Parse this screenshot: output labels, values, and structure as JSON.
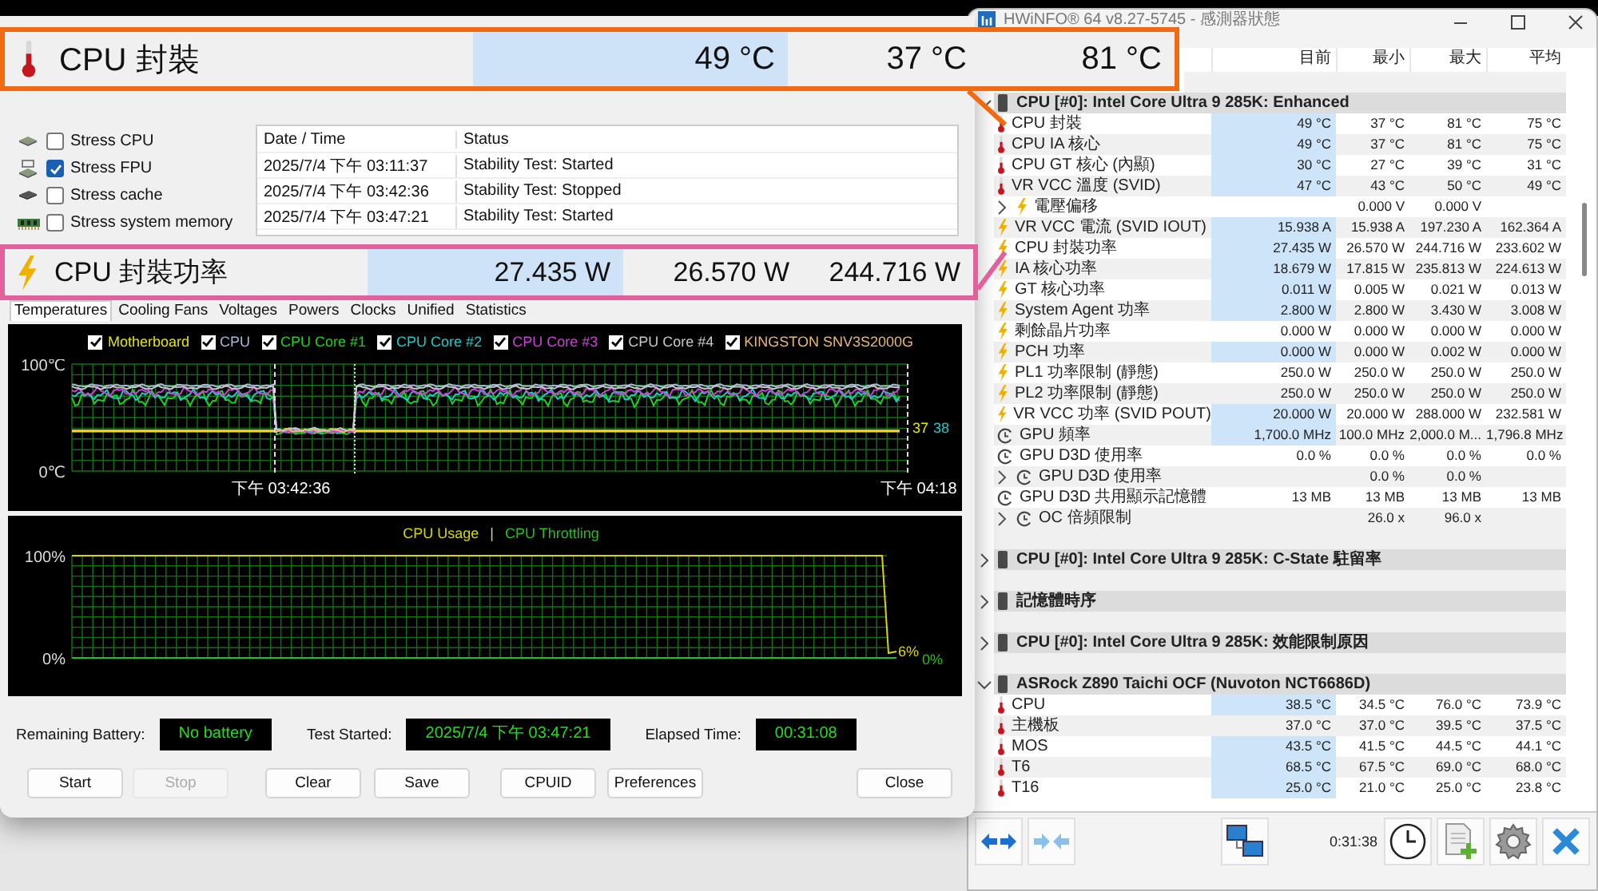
{
  "callouts": [
    {
      "kind": "temperature",
      "color": "#f26a10",
      "label": "CPU 封裝",
      "values": [
        "49 °C",
        "37 °C",
        "81 °C"
      ]
    },
    {
      "kind": "power",
      "color": "#e2609c",
      "label": "CPU 封裝功率",
      "values": [
        "27.435 W",
        "26.570 W",
        "244.716 W"
      ]
    }
  ],
  "stress_window": {
    "stress_options": [
      {
        "label": "Stress CPU",
        "checked": false
      },
      {
        "label": "Stress FPU",
        "checked": true
      },
      {
        "label": "Stress cache",
        "checked": false
      },
      {
        "label": "Stress system memory",
        "checked": false
      }
    ],
    "log": {
      "columns": [
        "Date / Time",
        "Status"
      ],
      "rows": [
        [
          "2025/7/4 下午 03:11:37",
          "Stability Test: Started"
        ],
        [
          "2025/7/4 下午 03:42:36",
          "Stability Test: Stopped"
        ],
        [
          "2025/7/4 下午 03:47:21",
          "Stability Test: Started"
        ]
      ]
    },
    "tabs": [
      {
        "label": "Temperatures",
        "selected": true
      },
      {
        "label": "Cooling Fans",
        "selected": false
      },
      {
        "label": "Voltages",
        "selected": false
      },
      {
        "label": "Powers",
        "selected": false
      },
      {
        "label": "Clocks",
        "selected": false
      },
      {
        "label": "Unified",
        "selected": false
      },
      {
        "label": "Statistics",
        "selected": false
      }
    ],
    "temperature_chart": {
      "legend": [
        {
          "label": "Motherboard",
          "color": "#e6e600",
          "checked": true
        },
        {
          "label": "CPU",
          "color": "#a8b8d8",
          "checked": true
        },
        {
          "label": "CPU Core #1",
          "color": "#20d020",
          "checked": true
        },
        {
          "label": "CPU Core #2",
          "color": "#20c8c8",
          "checked": true
        },
        {
          "label": "CPU Core #3",
          "color": "#d040d8",
          "checked": true
        },
        {
          "label": "CPU Core #4",
          "color": "#c8c8c8",
          "checked": true
        },
        {
          "label": "KINGSTON SNV3S2000G",
          "color": "#e8b878",
          "checked": true
        }
      ],
      "y_labels": [
        "100℃",
        "0℃"
      ],
      "time_labels": [
        "下午 03:42:36",
        "下午 04:18"
      ],
      "end_readings": [
        {
          "text": "37",
          "color": "#e6e600"
        },
        {
          "text": "38",
          "color": "#20c8c8"
        }
      ]
    },
    "usage_chart": {
      "legend": [
        {
          "label": "CPU Usage",
          "color": "#d8d800"
        },
        {
          "label": "CPU Throttling",
          "color": "#20c020"
        }
      ],
      "separator": "|",
      "y_labels": [
        "100%",
        "0%"
      ],
      "end_readings": [
        {
          "text": "6%",
          "color": "#d8d800"
        },
        {
          "text": "0%",
          "color": "#20c020"
        }
      ]
    },
    "status_fields": [
      {
        "label": "Remaining Battery:",
        "value": "No battery"
      },
      {
        "label": "Test Started:",
        "value": "2025/7/4 下午 03:47:21"
      },
      {
        "label": "Elapsed Time:",
        "value": "00:31:08"
      }
    ],
    "buttons": [
      {
        "label": "Start",
        "disabled": false
      },
      {
        "label": "Stop",
        "disabled": true
      },
      {
        "label": "Clear",
        "disabled": false
      },
      {
        "label": "Save",
        "disabled": false
      },
      {
        "label": "CPUID",
        "disabled": false
      },
      {
        "label": "Preferences",
        "disabled": false
      },
      {
        "label": "Close",
        "disabled": false
      }
    ]
  },
  "sensor_window": {
    "title": "HWiNFO® 64 v8.27-5745 - 感測器狀態",
    "columns": [
      "目前",
      "最小",
      "最大",
      "平均"
    ],
    "rows": [
      {
        "kind": "spacer"
      },
      {
        "kind": "group",
        "label": "CPU [#0]: Intel Core Ultra 9 285K: Enhanced",
        "expanded": true
      },
      {
        "kind": "temperature",
        "label": "CPU 封裝",
        "current": "49 °C",
        "min": "37 °C",
        "max": "81 °C",
        "avg": "75 °C",
        "highlighted": true
      },
      {
        "kind": "temperature",
        "label": "CPU IA 核心",
        "current": "49 °C",
        "min": "37 °C",
        "max": "81 °C",
        "avg": "75 °C",
        "highlighted": true
      },
      {
        "kind": "temperature",
        "label": "CPU GT 核心 (內顯)",
        "current": "30 °C",
        "min": "27 °C",
        "max": "39 °C",
        "avg": "31 °C",
        "highlighted": true
      },
      {
        "kind": "temperature",
        "label": "VR VCC 溫度 (SVID)",
        "current": "47 °C",
        "min": "43 °C",
        "max": "50 °C",
        "avg": "49 °C",
        "highlighted": true
      },
      {
        "kind": "power",
        "label": "電壓偏移",
        "min": "0.000 V",
        "max": "0.000 V",
        "expanded": false
      },
      {
        "kind": "power",
        "label": "VR VCC 電流 (SVID IOUT)",
        "current": "15.938 A",
        "min": "15.938 A",
        "max": "197.230 A",
        "avg": "162.364 A",
        "highlighted": true
      },
      {
        "kind": "power",
        "label": "CPU 封裝功率",
        "current": "27.435 W",
        "min": "26.570 W",
        "max": "244.716 W",
        "avg": "233.602 W",
        "highlighted": true
      },
      {
        "kind": "power",
        "label": "IA 核心功率",
        "current": "18.679 W",
        "min": "17.815 W",
        "max": "235.813 W",
        "avg": "224.613 W",
        "highlighted": true
      },
      {
        "kind": "power",
        "label": "GT 核心功率",
        "current": "0.011 W",
        "min": "0.005 W",
        "max": "0.021 W",
        "avg": "0.013 W",
        "highlighted": true
      },
      {
        "kind": "power",
        "label": "System Agent 功率",
        "current": "2.800 W",
        "min": "2.800 W",
        "max": "3.430 W",
        "avg": "3.008 W",
        "highlighted": true
      },
      {
        "kind": "power",
        "label": "剩餘晶片功率",
        "current": "0.000 W",
        "min": "0.000 W",
        "max": "0.000 W",
        "avg": "0.000 W",
        "highlighted": false
      },
      {
        "kind": "power",
        "label": "PCH 功率",
        "current": "0.000 W",
        "min": "0.000 W",
        "max": "0.002 W",
        "avg": "0.000 W",
        "highlighted": true
      },
      {
        "kind": "power",
        "label": "PL1 功率限制 (靜態)",
        "current": "250.0 W",
        "min": "250.0 W",
        "max": "250.0 W",
        "avg": "250.0 W",
        "highlighted": false
      },
      {
        "kind": "power",
        "label": "PL2 功率限制 (靜態)",
        "current": "250.0 W",
        "min": "250.0 W",
        "max": "250.0 W",
        "avg": "250.0 W",
        "highlighted": false
      },
      {
        "kind": "power",
        "label": "VR VCC 功率 (SVID POUT)",
        "current": "20.000 W",
        "min": "20.000 W",
        "max": "288.000 W",
        "avg": "232.581 W",
        "highlighted": true
      },
      {
        "kind": "clock",
        "label": "GPU 頻率",
        "current": "1,700.0 MHz",
        "min": "100.0 MHz",
        "max": "2,000.0 M...",
        "avg": "1,796.8 MHz",
        "highlighted": true
      },
      {
        "kind": "clock",
        "label": "GPU D3D 使用率",
        "current": "0.0 %",
        "min": "0.0 %",
        "max": "0.0 %",
        "avg": "0.0 %",
        "highlighted": false
      },
      {
        "kind": "clock",
        "label": "GPU D3D 使用率",
        "min": "0.0 %",
        "max": "0.0 %",
        "expanded": false
      },
      {
        "kind": "clock",
        "label": "GPU D3D 共用顯示記憶體",
        "current": "13 MB",
        "min": "13 MB",
        "max": "13 MB",
        "avg": "13 MB",
        "highlighted": false
      },
      {
        "kind": "clock",
        "label": "OC 倍頻限制",
        "min": "26.0 x",
        "max": "96.0 x",
        "expanded": false
      },
      {
        "kind": "spacer"
      },
      {
        "kind": "group",
        "label": "CPU [#0]: Intel Core Ultra 9 285K: C-State 駐留率",
        "expanded": false
      },
      {
        "kind": "spacer"
      },
      {
        "kind": "group",
        "label": "記憶體時序",
        "expanded": false
      },
      {
        "kind": "spacer"
      },
      {
        "kind": "group",
        "label": "CPU [#0]: Intel Core Ultra 9 285K: 效能限制原因",
        "expanded": false
      },
      {
        "kind": "spacer"
      },
      {
        "kind": "group",
        "label": "ASRock Z890 Taichi OCF (Nuvoton NCT6686D)",
        "expanded": true
      },
      {
        "kind": "temperature",
        "label": "CPU",
        "current": "38.5 °C",
        "min": "34.5 °C",
        "max": "76.0 °C",
        "avg": "73.9 °C",
        "highlighted": true
      },
      {
        "kind": "temperature",
        "label": "主機板",
        "current": "37.0 °C",
        "min": "37.0 °C",
        "max": "39.5 °C",
        "avg": "37.5 °C",
        "highlighted": false
      },
      {
        "kind": "temperature",
        "label": "MOS",
        "current": "43.5 °C",
        "min": "41.5 °C",
        "max": "44.5 °C",
        "avg": "44.1 °C",
        "highlighted": true
      },
      {
        "kind": "temperature",
        "label": "T6",
        "current": "68.5 °C",
        "min": "67.5 °C",
        "max": "69.0 °C",
        "avg": "68.0 °C",
        "highlighted": true
      },
      {
        "kind": "temperature",
        "label": "T16",
        "current": "25.0 °C",
        "min": "21.0 °C",
        "max": "25.0 °C",
        "avg": "23.8 °C",
        "highlighted": true
      }
    ],
    "timer": "0:31:38"
  }
}
